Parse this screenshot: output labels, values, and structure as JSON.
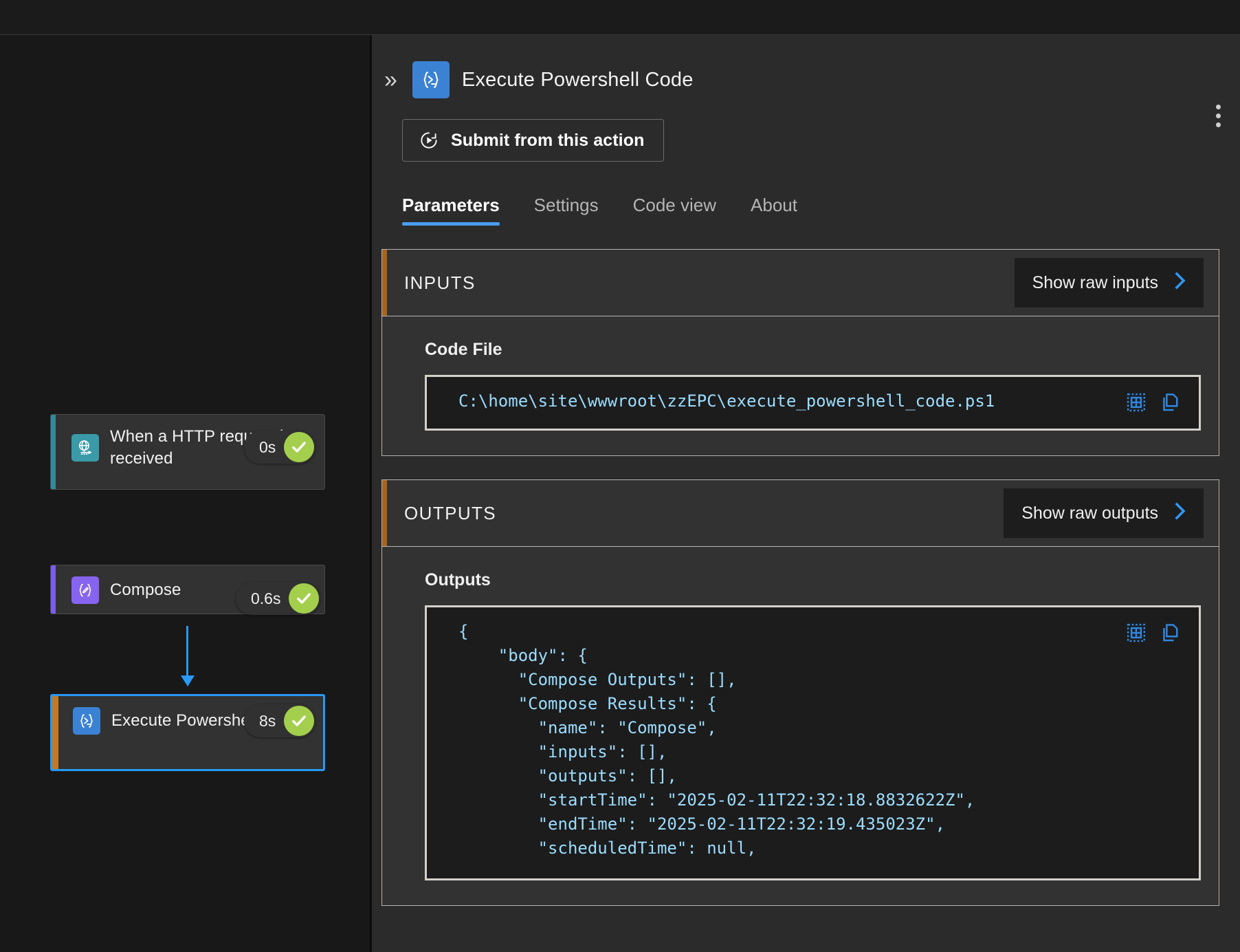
{
  "window": {
    "title": ""
  },
  "flow": {
    "nodes": [
      {
        "id": "http-trigger",
        "label": "When a HTTP request is received",
        "duration": "0s",
        "status": "succeeded",
        "accent_color": "#2e8b9c",
        "icon_bg": "#3a9aa8",
        "icon_name": "http-request-icon",
        "selected": false
      },
      {
        "id": "compose",
        "label": "Compose",
        "duration": "0.6s",
        "status": "succeeded",
        "accent_color": "#7a5cf0",
        "icon_bg": "#8764f0",
        "icon_name": "compose-braces-icon",
        "selected": false
      },
      {
        "id": "execute-powershell-code",
        "label": "Execute Powershell Code",
        "duration": "8s",
        "status": "succeeded",
        "accent_color": "#c47a20",
        "icon_bg": "#3b82d4",
        "icon_name": "powershell-icon",
        "selected": true
      }
    ],
    "connector_colors": {
      "first": "#9a9a9a",
      "second": "#2899f5"
    }
  },
  "panel": {
    "collapse_icon": "»",
    "title": "Execute Powershell Code",
    "icon_name": "powershell-icon",
    "more_menu_label": "",
    "submit_button": "Submit from this action",
    "tabs": [
      {
        "label": "Parameters",
        "active": true
      },
      {
        "label": "Settings",
        "active": false
      },
      {
        "label": "Code view",
        "active": false
      },
      {
        "label": "About",
        "active": false
      }
    ],
    "inputs": {
      "section_title": "INPUTS",
      "raw_button": "Show raw inputs",
      "field_label": "Code File",
      "field_value": "C:\\home\\site\\wwwroot\\zzEPC\\execute_powershell_code.ps1"
    },
    "outputs": {
      "section_title": "OUTPUTS",
      "raw_button": "Show raw outputs",
      "field_label": "Outputs",
      "field_value": "{\n    \"body\": {\n      \"Compose Outputs\": [],\n      \"Compose Results\": {\n        \"name\": \"Compose\",\n        \"inputs\": [],\n        \"outputs\": [],\n        \"startTime\": \"2025-02-11T22:32:18.8832622Z\",\n        \"endTime\": \"2025-02-11T22:32:19.435023Z\",\n        \"scheduledTime\": null,"
    }
  },
  "colors": {
    "accent_blue": "#2899f5",
    "section_accent_orange": "#a8641e",
    "success_green": "#a4cf4c",
    "code_text_blue": "#9cdcfe",
    "panel_bg": "#2b2b2b",
    "canvas_bg": "#181818"
  }
}
